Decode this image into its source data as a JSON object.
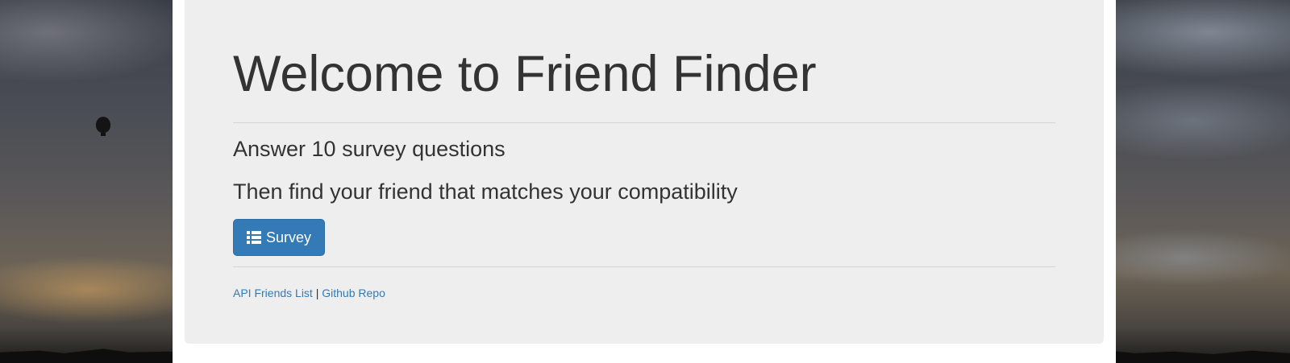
{
  "page": {
    "heading": "Welcome to Friend Finder",
    "line1": "Answer 10 survey questions",
    "line2": "Then find your friend that matches your compatibility"
  },
  "survey_button": {
    "label": "Survey",
    "icon": "list-icon"
  },
  "footer": {
    "api_link": "API Friends List",
    "separator": "|",
    "github_link": "Github Repo"
  },
  "colors": {
    "primary": "#337ab7",
    "jumbotron_bg": "#eeeeee",
    "text": "#333333"
  }
}
